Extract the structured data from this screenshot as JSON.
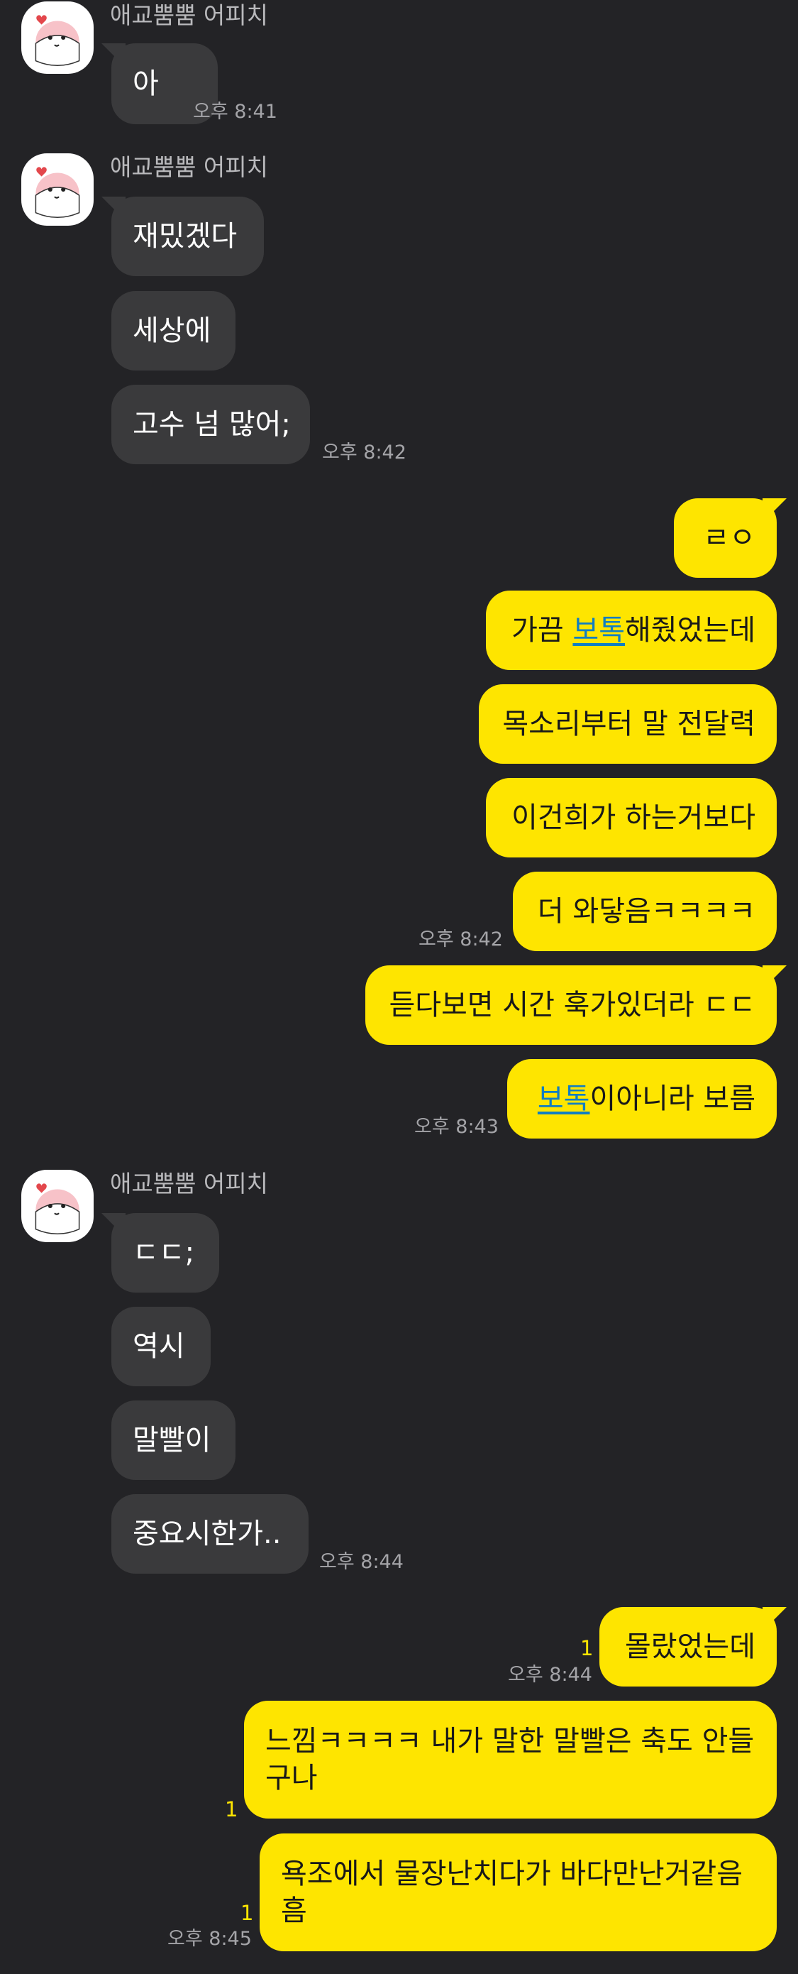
{
  "chat": {
    "sender_name": "애교뿜뿜 어피치",
    "messages": {
      "m1": "아",
      "m2": "재밌겠다",
      "m3": "세상에",
      "m4": "고수 넘 많어;",
      "m5": "ㄹㅇ",
      "m6_pre": "가끔 ",
      "m6_link": "보톡",
      "m6_post": "해줬었는데",
      "m7": "목소리부터 말 전달력",
      "m8": "이건희가 하는거보다",
      "m9": "더 와닿음ㅋㅋㅋㅋ",
      "m10": "듣다보면 시간 훅가있더라 ㄷㄷ",
      "m11_link": "보톡",
      "m11_post": "이아니라 보름",
      "m12": "ㄷㄷ;",
      "m13": "역시",
      "m14": "말빨이",
      "m15": "중요시한가..",
      "m16": "몰랐었는데",
      "m17": "느낌ㅋㅋㅋㅋ 내가 말한 말빨은 축도 안들구나",
      "m18": "욕조에서 물장난치다가 바다만난거같음흠"
    },
    "times": {
      "t1": "오후 8:41",
      "t2": "오후 8:42",
      "t3": "오후 8:42",
      "t4": "오후 8:43",
      "t5": "오후 8:44",
      "t6": "오후 8:44",
      "t7": "오후 8:45"
    },
    "unread_count": "1"
  },
  "colors": {
    "background": "#232326",
    "incoming_bubble": "#3a3a3c",
    "outgoing_bubble": "#fee500",
    "unread": "#fee500",
    "link": "#117ec2"
  },
  "icons": {
    "avatar": "apeach-character-icon"
  }
}
